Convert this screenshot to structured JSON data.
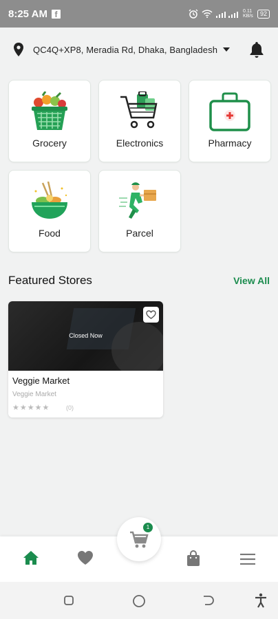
{
  "status_bar": {
    "time": "8:25 AM",
    "battery": "92",
    "network": "0.11 KB/s"
  },
  "location": {
    "address": "QC4Q+XP8, Meradia Rd, Dhaka, Bangladesh"
  },
  "modules": [
    {
      "label": "Grocery",
      "icon": "grocery-basket-icon"
    },
    {
      "label": "Electronics",
      "icon": "shopping-cart-icon"
    },
    {
      "label": "Pharmacy",
      "icon": "medical-bag-icon"
    },
    {
      "label": "Food",
      "icon": "food-bowl-icon"
    },
    {
      "label": "Parcel",
      "icon": "delivery-man-icon"
    }
  ],
  "featured": {
    "title": "Featured Stores",
    "view_all": "View All",
    "stores": [
      {
        "name": "Veggie Market",
        "subtitle": "Veggie Market",
        "status": "Closed Now",
        "rating_count": "(0)",
        "rating": 0
      }
    ]
  },
  "cart": {
    "count": "1"
  },
  "colors": {
    "accent": "#1b8c4e",
    "background": "#f1f2f2",
    "statusbar": "#8d8d8d"
  }
}
